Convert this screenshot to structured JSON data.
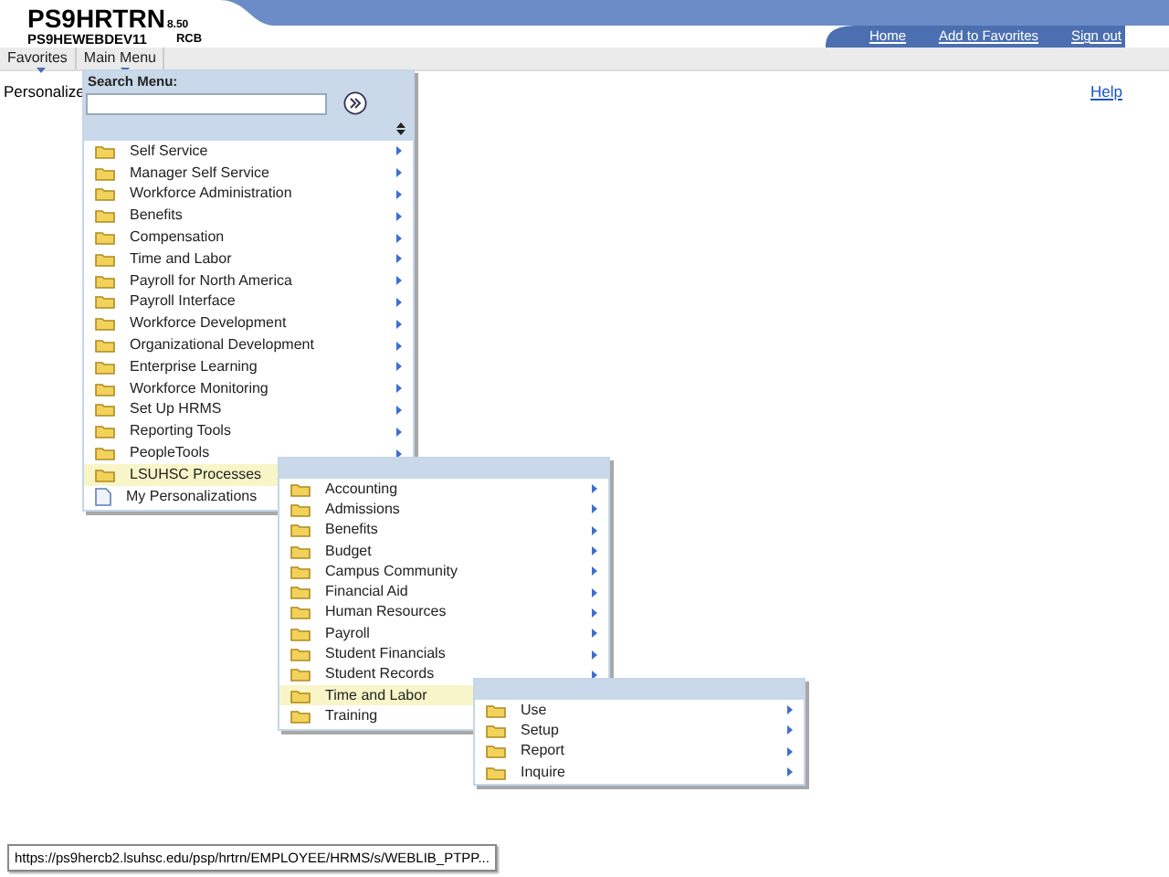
{
  "header": {
    "system": "PS9HRTRN",
    "version": "8.50",
    "server": "PS9HEWEBDEV11",
    "user": "RCB",
    "links": [
      {
        "label": "Home"
      },
      {
        "label": "Add to Favorites"
      },
      {
        "label": "Sign out"
      }
    ]
  },
  "nav": [
    {
      "label": "Favorites"
    },
    {
      "label": "Main Menu"
    }
  ],
  "page": {
    "title": "Personalize",
    "help": "Help"
  },
  "menu": {
    "search_label": "Search Menu:",
    "items": [
      {
        "label": "Self Service",
        "kind": "folder",
        "selected": false
      },
      {
        "label": "Manager Self Service",
        "kind": "folder",
        "selected": false
      },
      {
        "label": "Workforce Administration",
        "kind": "folder",
        "selected": false
      },
      {
        "label": "Benefits",
        "kind": "folder",
        "selected": false
      },
      {
        "label": "Compensation",
        "kind": "folder",
        "selected": false
      },
      {
        "label": "Time and Labor",
        "kind": "folder",
        "selected": false
      },
      {
        "label": "Payroll for North America",
        "kind": "folder",
        "selected": false
      },
      {
        "label": "Payroll Interface",
        "kind": "folder",
        "selected": false
      },
      {
        "label": "Workforce Development",
        "kind": "folder",
        "selected": false
      },
      {
        "label": "Organizational Development",
        "kind": "folder",
        "selected": false
      },
      {
        "label": "Enterprise Learning",
        "kind": "folder",
        "selected": false
      },
      {
        "label": "Workforce Monitoring",
        "kind": "folder",
        "selected": false
      },
      {
        "label": "Set Up HRMS",
        "kind": "folder",
        "selected": false
      },
      {
        "label": "Reporting Tools",
        "kind": "folder",
        "selected": false
      },
      {
        "label": "PeopleTools",
        "kind": "folder",
        "selected": false
      },
      {
        "label": "LSUHSC Processes",
        "kind": "folder",
        "selected": true,
        "children": [
          {
            "label": "Accounting",
            "kind": "folder",
            "selected": false
          },
          {
            "label": "Admissions",
            "kind": "folder",
            "selected": false
          },
          {
            "label": "Benefits",
            "kind": "folder",
            "selected": false
          },
          {
            "label": "Budget",
            "kind": "folder",
            "selected": false
          },
          {
            "label": "Campus Community",
            "kind": "folder",
            "selected": false
          },
          {
            "label": "Financial Aid",
            "kind": "folder",
            "selected": false
          },
          {
            "label": "Human Resources",
            "kind": "folder",
            "selected": false
          },
          {
            "label": "Payroll",
            "kind": "folder",
            "selected": false
          },
          {
            "label": "Student Financials",
            "kind": "folder",
            "selected": false
          },
          {
            "label": "Student Records",
            "kind": "folder",
            "selected": false
          },
          {
            "label": "Time and Labor",
            "kind": "folder",
            "selected": true,
            "children": [
              {
                "label": "Use",
                "kind": "folder",
                "selected": false
              },
              {
                "label": "Setup",
                "kind": "folder",
                "selected": false
              },
              {
                "label": "Report",
                "kind": "folder",
                "selected": false
              },
              {
                "label": "Inquire",
                "kind": "folder",
                "selected": false
              }
            ]
          },
          {
            "label": "Training",
            "kind": "folder",
            "selected": false
          }
        ]
      },
      {
        "label": "My Personalizations",
        "kind": "page",
        "selected": false
      }
    ]
  },
  "status_url": "https://ps9hercb2.lsuhsc.edu/psp/hrtrn/EMPLOYEE/HRMS/s/WEBLIB_PTPP..."
}
